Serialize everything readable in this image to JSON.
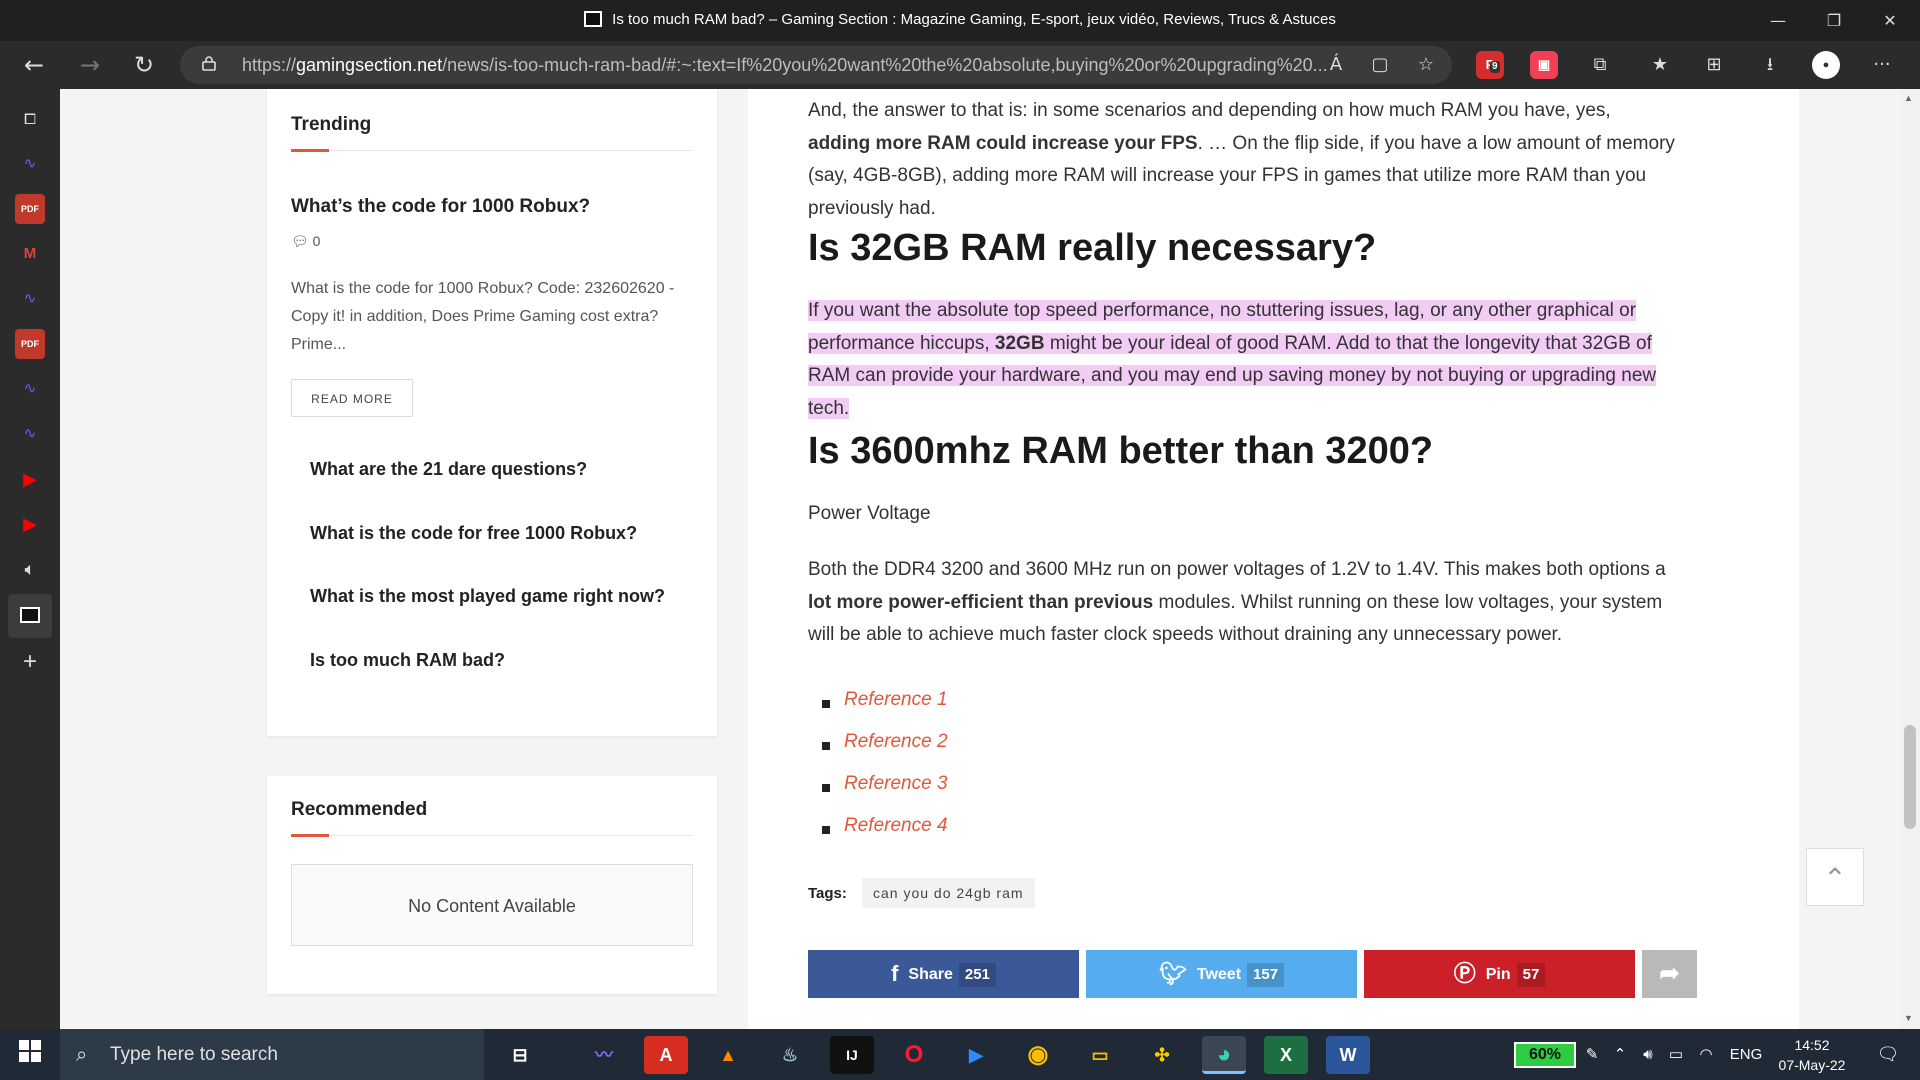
{
  "window": {
    "title": "Is too much RAM bad? – Gaming Section : Magazine Gaming, E-sport, jeux vidéo, Reviews, Trucs & Astuces",
    "minimize": "—",
    "restore": "❐",
    "close": "✕"
  },
  "toolbar": {
    "back": "←",
    "forward": "→",
    "refresh": "↻",
    "url_prefix": "https://",
    "url_domain": "gamingsection.net",
    "url_path": "/news/is-too-much-ram-bad/#:~:text=If%20you%20want%20the%20absolute,buying%20or%20upgrading%20...",
    "read_aloud": "Á",
    "ext_badge": "9",
    "menu": "···"
  },
  "sidebar_widgets": {
    "trending": {
      "title": "Trending",
      "first_title": "What’s the code for 1000 Robux?",
      "comment_count": "0",
      "excerpt": "What is the code for 1000 Robux? Code: 232602620 - Copy it! in addition, Does Prime Gaming cost extra? Prime...",
      "read_more": "READ MORE",
      "links": [
        "What are the 21 dare questions?",
        "What is the code for free 1000 Robux?",
        "What is the most played game right now?",
        "Is too much RAM bad?"
      ]
    },
    "recommended": {
      "title": "Recommended",
      "empty": "No Content Available"
    }
  },
  "article": {
    "intro_1": "And, the answer to that is: in some scenarios and depending on how much RAM you have, yes, ",
    "intro_bold": "adding more RAM could increase your FPS",
    "intro_2": ". … On the flip side, if you have a low amount of memory (say, 4GB-8GB), adding more RAM will increase your FPS in games that utilize more RAM than you previously had.",
    "heading_1": "Is 32GB RAM really necessary?",
    "hl_1": "If you want the absolute top speed performance, no stuttering issues, lag, or any other graphical or performance hiccups, ",
    "hl_bold": "32GB",
    "hl_2": " might be your ideal of good RAM. Add to that the longevity that 32GB of RAM can provide your hardware, and you may end up saving money by not buying or upgrading new tech.",
    "heading_2": "Is 3600mhz RAM better than 3200?",
    "subtext": "Power Voltage",
    "body_1": "Both the DDR4 3200 and 3600 MHz run on power voltages of 1.2V to 1.4V. This makes both options a ",
    "body_bold": "lot more power-efficient than previous",
    "body_2": " modules. Whilst running on these low voltages, your system will be able to achieve much faster clock speeds without draining any unnecessary power.",
    "references": [
      "Reference 1",
      "Reference 2",
      "Reference 3",
      "Reference 4"
    ],
    "tags_label": "Tags:",
    "tag": "can you do 24gb ram",
    "share": {
      "facebook_label": "Share",
      "facebook_count": "251",
      "twitter_label": "Tweet",
      "twitter_count": "157",
      "pinterest_label": "Pin",
      "pinterest_count": "57"
    }
  },
  "taskbar": {
    "search_placeholder": "Type here to search",
    "battery": "60%",
    "language": "ENG",
    "time": "14:52",
    "date": "07-May-22"
  },
  "colors": {
    "accent": "#e2573b",
    "highlight": "#f2ccf5",
    "facebook": "#3b5998",
    "twitter": "#55acee",
    "pinterest": "#cb2027",
    "share_more": "#b9b9b9"
  }
}
